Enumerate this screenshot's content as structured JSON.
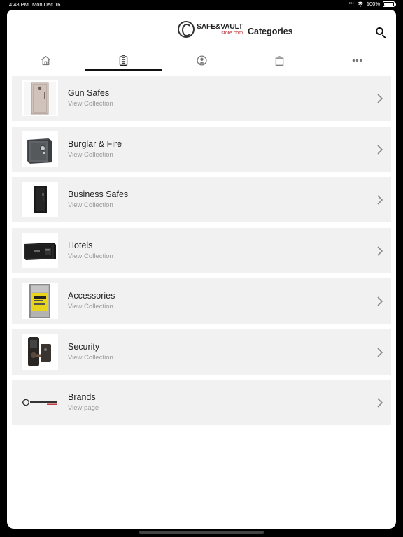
{
  "status_bar": {
    "time": "4:48 PM",
    "date": "Mon Dec 16",
    "battery": "100%",
    "signal_icon": "wifi-icon",
    "battery_level": 1.0
  },
  "header": {
    "logo_main": "SAFE&VAULT",
    "logo_sub": "store.com",
    "title": "Categories",
    "search_icon": "search-icon"
  },
  "tabs": [
    {
      "icon": "home-icon",
      "active": false
    },
    {
      "icon": "clipboard-icon",
      "active": true
    },
    {
      "icon": "account-icon",
      "active": false
    },
    {
      "icon": "shopping-bag-icon",
      "active": false
    },
    {
      "icon": "more-icon",
      "active": false
    }
  ],
  "categories": [
    {
      "title": "Gun Safes",
      "subtitle": "View Collection",
      "thumb": "gun-safe-image"
    },
    {
      "title": "Burglar & Fire",
      "subtitle": "View Collection",
      "thumb": "burglar-safe-image"
    },
    {
      "title": "Business Safes",
      "subtitle": "View Collection",
      "thumb": "business-safe-image"
    },
    {
      "title": "Hotels",
      "subtitle": "View Collection",
      "thumb": "hotel-safe-image"
    },
    {
      "title": "Accessories",
      "subtitle": "View Collection",
      "thumb": "accessories-image"
    },
    {
      "title": "Security",
      "subtitle": "View Collection",
      "thumb": "security-lock-image"
    },
    {
      "title": "Brands",
      "subtitle": "View page",
      "thumb": "brands-logo-image"
    }
  ],
  "colors": {
    "row_bg": "#f1f1f1",
    "subtitle": "#9b9b9b",
    "brand_red": "#c0272d"
  }
}
